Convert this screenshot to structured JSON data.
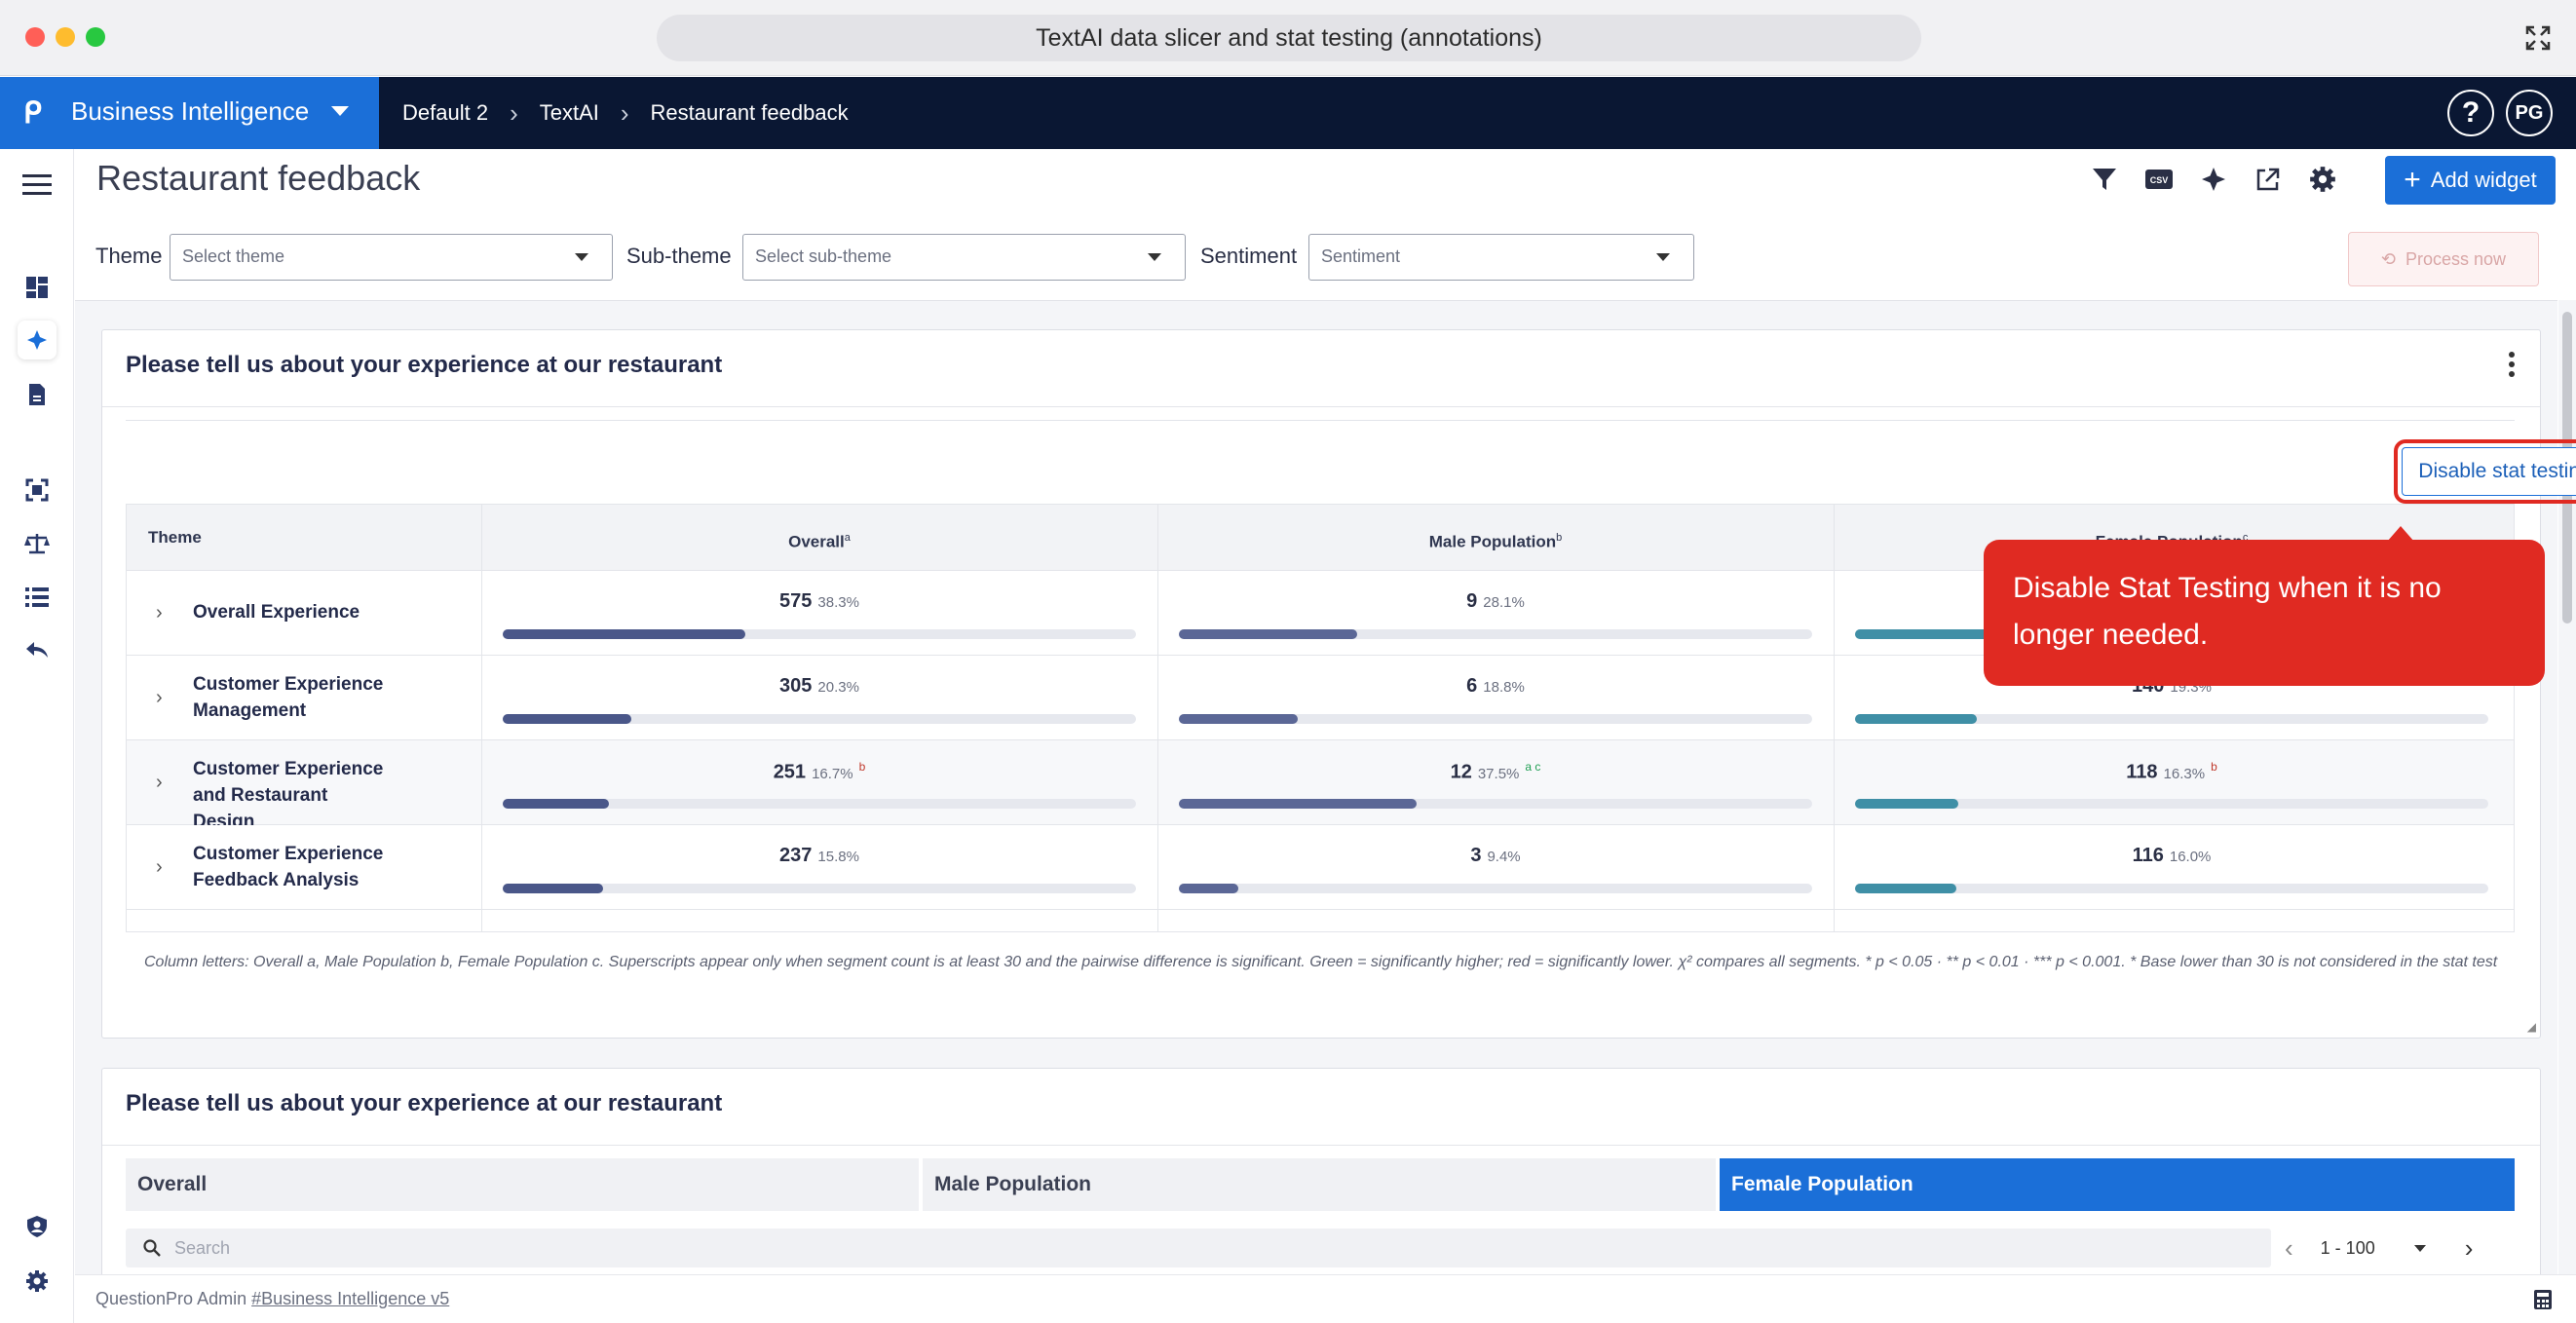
{
  "window": {
    "title": "TextAI data slicer and stat testing (annotations)"
  },
  "nav": {
    "brand": "Business Intelligence",
    "breadcrumbs": [
      "Default 2",
      "TextAI",
      "Restaurant feedback"
    ],
    "help": "?",
    "avatar": "PG"
  },
  "sidebar": {
    "items": [
      "menu-icon",
      "dashboard-icon",
      "textai-icon",
      "report-icon",
      "scan-icon",
      "scale-icon",
      "list-icon",
      "reply-icon",
      "user-shield-icon",
      "settings-icon"
    ]
  },
  "page": {
    "title": "Restaurant feedback",
    "add_widget": "Add widget",
    "toolbar_icons": [
      "filter-icon",
      "csv-icon",
      "sparkle-icon",
      "share-icon",
      "gear-icon"
    ]
  },
  "filters": {
    "theme_label": "Theme",
    "theme_placeholder": "Select theme",
    "subtheme_label": "Sub-theme",
    "subtheme_placeholder": "Select sub-theme",
    "sentiment_label": "Sentiment",
    "sentiment_placeholder": "Sentiment",
    "process_now": "Process now"
  },
  "widget1": {
    "title": "Please tell us about your experience at our restaurant",
    "disable_button": "Disable stat testing",
    "columns": [
      {
        "label": "Theme",
        "sup": ""
      },
      {
        "label": "Overall",
        "sup": "a"
      },
      {
        "label": "Male Population",
        "sup": "b"
      },
      {
        "label": "Female Population",
        "sup": "c"
      }
    ],
    "rows": [
      {
        "label": "Overall Experience",
        "cells": [
          {
            "count": "575",
            "pct": "38.3%",
            "fill": 0.383,
            "sig": "",
            "sig_color": ""
          },
          {
            "count": "9",
            "pct": "28.1%",
            "fill": 0.281,
            "sig": "",
            "sig_color": ""
          },
          {
            "count": "",
            "pct": "",
            "fill": 0.3,
            "sig": "",
            "sig_color": ""
          }
        ]
      },
      {
        "label": "Customer Experience Management",
        "cells": [
          {
            "count": "305",
            "pct": "20.3%",
            "fill": 0.203,
            "sig": "",
            "sig_color": ""
          },
          {
            "count": "6",
            "pct": "18.8%",
            "fill": 0.188,
            "sig": "",
            "sig_color": ""
          },
          {
            "count": "140",
            "pct": "19.3%",
            "fill": 0.193,
            "sig": "",
            "sig_color": ""
          }
        ]
      },
      {
        "label": "Customer Experience and Restaurant Design",
        "cells": [
          {
            "count": "251",
            "pct": "16.7%",
            "fill": 0.167,
            "sig": "b",
            "sig_color": "red"
          },
          {
            "count": "12",
            "pct": "37.5%",
            "fill": 0.375,
            "sig": "a c",
            "sig_color": "green"
          },
          {
            "count": "118",
            "pct": "16.3%",
            "fill": 0.163,
            "sig": "b",
            "sig_color": "red"
          }
        ]
      },
      {
        "label": "Customer Experience Feedback Analysis",
        "cells": [
          {
            "count": "237",
            "pct": "15.8%",
            "fill": 0.158,
            "sig": "",
            "sig_color": ""
          },
          {
            "count": "3",
            "pct": "9.4%",
            "fill": 0.094,
            "sig": "",
            "sig_color": ""
          },
          {
            "count": "116",
            "pct": "16.0%",
            "fill": 0.16,
            "sig": "",
            "sig_color": ""
          }
        ]
      }
    ],
    "bar_colors": [
      "#4a5789",
      "#5b6796",
      "#3f8fa6"
    ],
    "footnote": "Column letters: Overall a, Male Population b, Female Population c. Superscripts appear only when segment count is at least 30 and the pairwise difference is significant. Green = significantly higher; red = significantly lower. χ² compares all segments. * p < 0.05 · ** p < 0.01 · *** p < 0.001. * Base lower than 30 is not considered in the stat test"
  },
  "callout": {
    "text": "Disable Stat Testing when it is no longer needed."
  },
  "widget2": {
    "title": "Please tell us about your experience at our restaurant",
    "segments": [
      "Overall",
      "Male Population",
      "Female Population"
    ],
    "active_segment": "Female Population",
    "search_placeholder": "Search",
    "pager": "1 - 100"
  },
  "footer": {
    "prefix": "QuestionPro Admin",
    "link": "#Business Intelligence v5"
  }
}
